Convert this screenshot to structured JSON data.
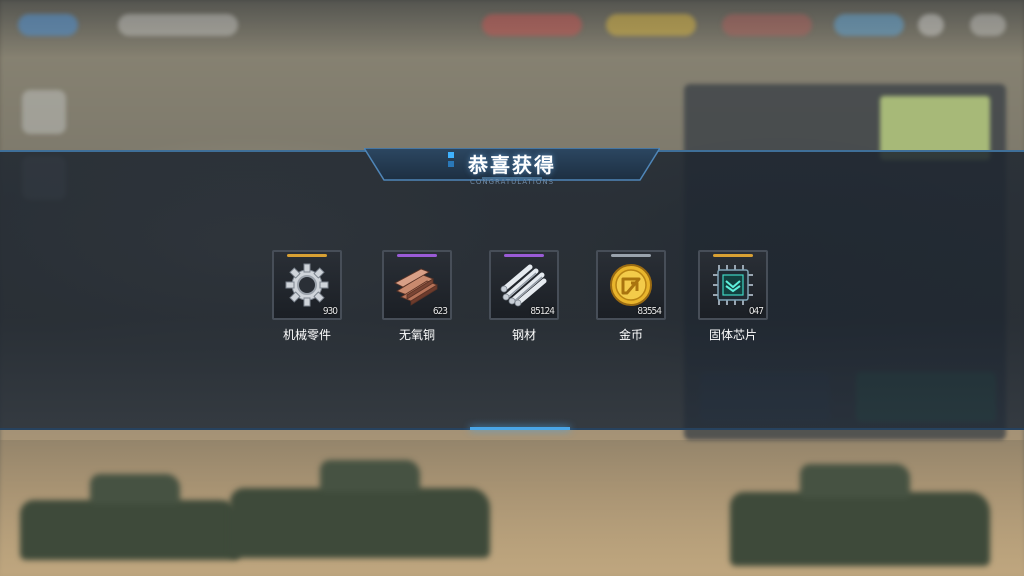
{
  "dialog": {
    "title": "恭喜获得",
    "subtitle": "CONGRATULATIONS"
  },
  "rewards": [
    {
      "name": "机械零件",
      "count": "930",
      "icon": "gear-icon",
      "rarity_color": "#d8a033"
    },
    {
      "name": "无氧铜",
      "count": "623",
      "icon": "copper-bars-icon",
      "rarity_color": "#9a5bd6"
    },
    {
      "name": "钢材",
      "count": "85124",
      "icon": "steel-rods-icon",
      "rarity_color": "#9a5bd6"
    },
    {
      "name": "金币",
      "count": "83554",
      "icon": "gold-coin-icon",
      "rarity_color": "#9aa3ad"
    },
    {
      "name": "固体芯片",
      "count": "047",
      "icon": "chip-icon",
      "rarity_color": "#d8a033"
    }
  ]
}
